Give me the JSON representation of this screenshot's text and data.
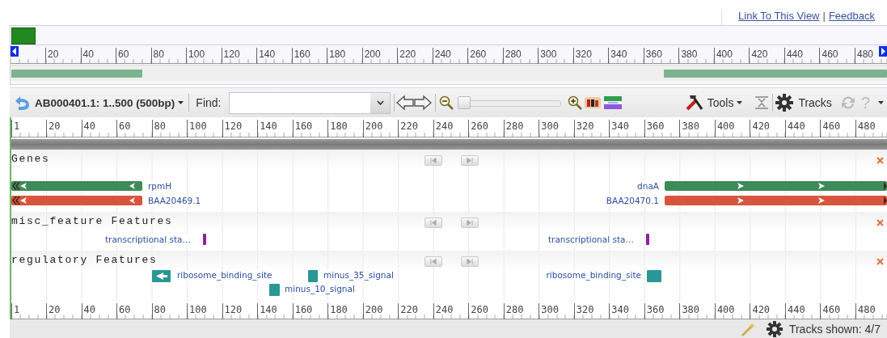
{
  "header": {
    "links": [
      "Link To This View",
      "Feedback"
    ],
    "separator": "|"
  },
  "overview": {
    "ruler_ticks": [
      "20",
      "40",
      "60",
      "80",
      "100",
      "120",
      "140",
      "160",
      "180",
      "200",
      "220",
      "240",
      "260",
      "280",
      "300",
      "320",
      "340",
      "360",
      "380",
      "400",
      "420",
      "440",
      "460",
      "480"
    ]
  },
  "toolbar": {
    "location": "AB000401.1: 1..500 (500bp)",
    "find_label": "Find:",
    "zoom": {
      "level": 0.0
    },
    "tools_label": "Tools",
    "tracks_label": "Tracks",
    "help": "?"
  },
  "ruler_ticks": [
    "1",
    "20",
    "40",
    "60",
    "80",
    "100",
    "120",
    "140",
    "160",
    "180",
    "200",
    "220",
    "240",
    "260",
    "280",
    "300",
    "320",
    "340",
    "360",
    "380",
    "400",
    "420",
    "440",
    "460",
    "480"
  ],
  "tracks": [
    {
      "name": "Genes",
      "features": [
        {
          "kind": "bar",
          "label": "rpmH",
          "color": "#3e8a58",
          "reverse": true
        },
        {
          "kind": "bar",
          "label": "dnaA",
          "color": "#3e8a58",
          "reverse": false
        },
        {
          "kind": "bar",
          "label": "BAA20469.1",
          "color": "#d8553d",
          "reverse": true
        },
        {
          "kind": "bar",
          "label": "BAA20470.1",
          "color": "#d8553d",
          "reverse": false
        }
      ]
    },
    {
      "name": "misc_feature Features",
      "features": [
        {
          "kind": "mark",
          "label": "transcriptional sta…",
          "color": "#8e1f9e"
        },
        {
          "kind": "mark",
          "label": "transcriptional sta…",
          "color": "#8e1f9e"
        }
      ]
    },
    {
      "name": "regulatory Features",
      "features": [
        {
          "kind": "box",
          "label": "ribosome_binding_site",
          "color": "#2a9794",
          "reverse": true
        },
        {
          "kind": "box",
          "label": "minus_35_signal",
          "color": "#2a9794",
          "reverse": false
        },
        {
          "kind": "box",
          "label": "ribosome_binding_site",
          "color": "#2a9794",
          "reverse": false
        },
        {
          "kind": "box",
          "label": "minus_10_signal",
          "color": "#2a9794",
          "reverse": false
        }
      ]
    }
  ],
  "bottom_ruler_ticks": [
    "1",
    "20",
    "40",
    "60",
    "80",
    "100",
    "120",
    "140",
    "160",
    "180",
    "200",
    "220",
    "240",
    "260",
    "280",
    "300",
    "320",
    "340",
    "360",
    "380",
    "400",
    "420",
    "440",
    "460",
    "480"
  ],
  "status": {
    "text": "Tracks shown: 4/7"
  }
}
